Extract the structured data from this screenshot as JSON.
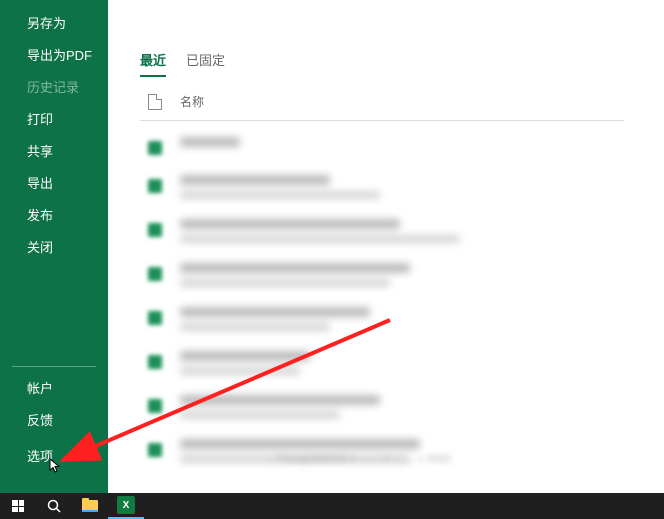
{
  "sidebar": {
    "items_top": [
      {
        "label": "另存为"
      },
      {
        "label": "导出为PDF"
      },
      {
        "label": "历史记录",
        "dim": true
      },
      {
        "label": "打印"
      },
      {
        "label": "共享"
      },
      {
        "label": "导出"
      },
      {
        "label": "发布"
      },
      {
        "label": "关闭"
      }
    ],
    "items_bottom": [
      {
        "label": "帐户"
      },
      {
        "label": "反馈"
      }
    ],
    "options_label": "选项"
  },
  "main": {
    "tabs": [
      {
        "label": "最近",
        "active": true
      },
      {
        "label": "已固定",
        "active": false
      }
    ],
    "header_name": "名称"
  },
  "file_rows": [
    {
      "tw": 60,
      "sw": 0
    },
    {
      "tw": 150,
      "sw": 200
    },
    {
      "tw": 220,
      "sw": 280
    },
    {
      "tw": 230,
      "sw": 210
    },
    {
      "tw": 190,
      "sw": 150
    },
    {
      "tw": 130,
      "sw": 120
    },
    {
      "tw": 200,
      "sw": 160
    },
    {
      "tw": 240,
      "sw": 230
    }
  ],
  "blurred_path": "…\\Yunqishi2019 » …… » …… » 2021",
  "taskbar": {
    "excel_letter": "X"
  }
}
